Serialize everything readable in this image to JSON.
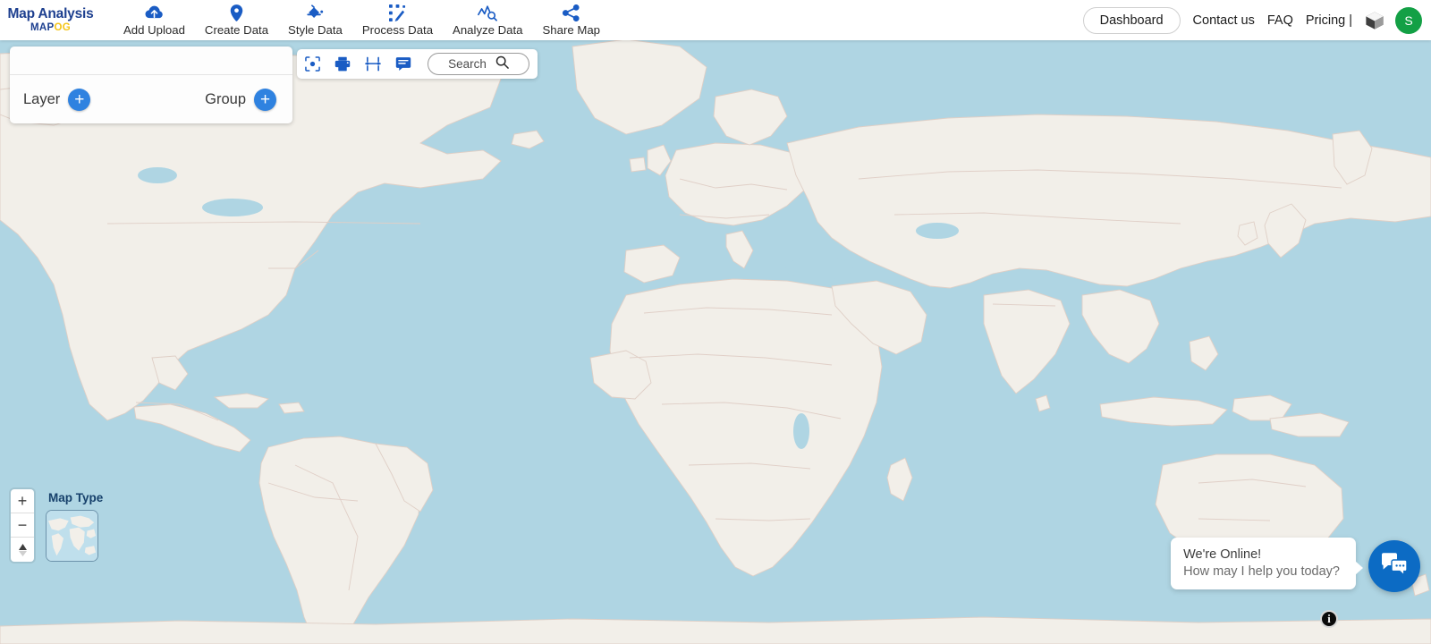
{
  "brand": {
    "title": "Map Analysis",
    "sub_main": "MAP",
    "sub_accent": "OG",
    "accent_color": "#f5c518",
    "brand_color": "#1d3f8f"
  },
  "topnav": {
    "items": [
      {
        "label": "Add Upload",
        "icon": "cloud-upload-icon"
      },
      {
        "label": "Create Data",
        "icon": "map-pin-icon"
      },
      {
        "label": "Style Data",
        "icon": "paint-bucket-icon"
      },
      {
        "label": "Process Data",
        "icon": "process-nodes-icon"
      },
      {
        "label": "Analyze Data",
        "icon": "analyze-chart-icon"
      },
      {
        "label": "Share Map",
        "icon": "share-icon"
      }
    ],
    "dashboard_label": "Dashboard",
    "links": [
      "Contact us",
      "FAQ",
      "Pricing |"
    ],
    "cube_icon": "cube-3d-icon",
    "avatar_initial": "S",
    "avatar_color": "#13a045"
  },
  "layer_panel": {
    "layer_label": "Layer",
    "group_label": "Group",
    "add_symbol": "+",
    "button_color": "#2f82e0"
  },
  "map_toolbar": {
    "tools": [
      {
        "name": "center-focus-icon"
      },
      {
        "name": "print-icon"
      },
      {
        "name": "measure-distance-icon"
      },
      {
        "name": "comment-icon"
      }
    ],
    "search_placeholder": "Search",
    "search_value": "",
    "search_icon": "search-icon"
  },
  "map_controls": {
    "zoom_in": "+",
    "zoom_out": "−",
    "compass_icon": "compass-north-icon"
  },
  "map_type": {
    "label": "Map Type",
    "selected_thumb": "world-basemap-thumb"
  },
  "chat_widget": {
    "line1": "We're Online!",
    "line2": "How may I help you today?",
    "fab_icon": "chat-bubbles-icon",
    "fab_color": "#0c6bc4"
  },
  "attribution": {
    "info_label": "i"
  },
  "map_style": {
    "ocean_color": "#afd5e3",
    "land_color": "#f2efe9",
    "border_color": "#e0cfc7"
  }
}
